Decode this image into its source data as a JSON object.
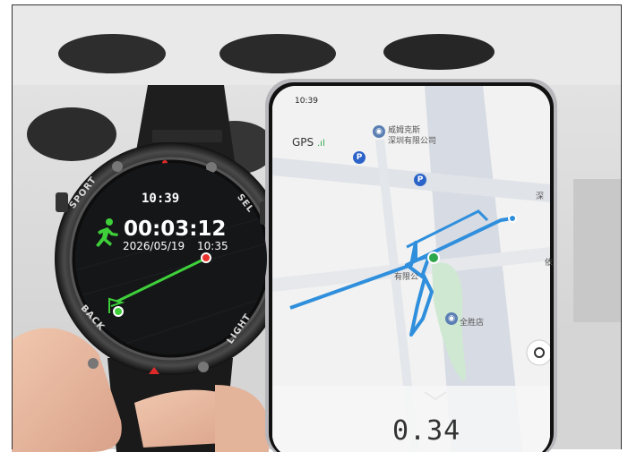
{
  "phone": {
    "status_time": "10:39",
    "gps_label": "GPS",
    "map_labels": {
      "poi_top_1": "威姆克斯",
      "poi_top_2": "深圳有限公司",
      "poi_bottom": "全胜店",
      "poi_mid": "有限公",
      "poi_right": "依",
      "poi_right_top": "深"
    },
    "distance": "0.34"
  },
  "watch": {
    "time": "10:39",
    "duration": "00:03:12",
    "date": "2026/05/19",
    "end_time": "10:35",
    "bezel_labels": {
      "top_left": "SPORT",
      "top_right": "SEL",
      "bottom_left": "BACK",
      "bottom_right": "LIGHT"
    }
  },
  "colors": {
    "track_blue": "#2f8fdc",
    "track_green": "#3ecf3a",
    "watch_end_red": "#e8322b",
    "watch_strap_red": "#d22b2b",
    "map_road": "#d7dbe3",
    "map_bg": "#f1f2f1"
  },
  "icons": [
    "running-person-icon",
    "location-target-icon",
    "parking-icon",
    "chevron-down-icon",
    "start-flag-icon"
  ]
}
